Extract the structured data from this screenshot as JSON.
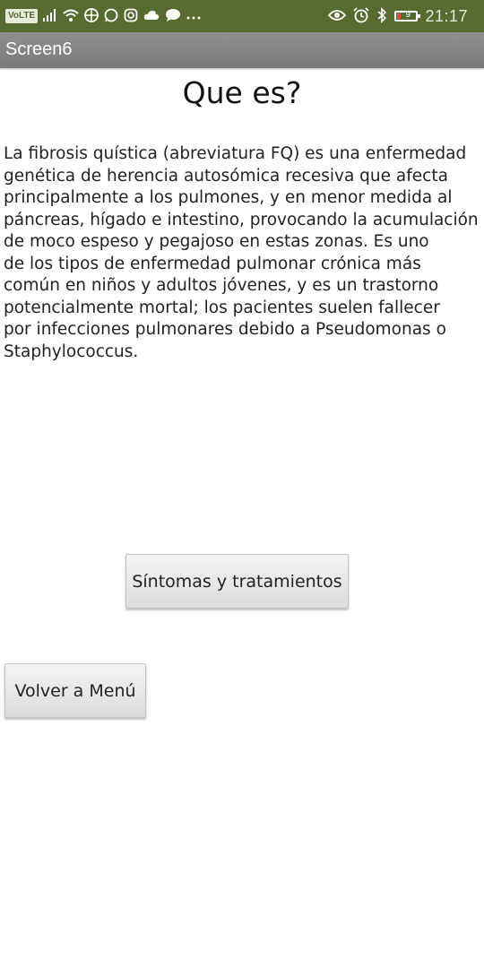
{
  "status_bar": {
    "volte": "VoLTE",
    "battery_level": "9",
    "time": "21:17",
    "icons_left": [
      "signal-icon",
      "wifi-icon",
      "basketball-icon",
      "whatsapp-icon",
      "instagram-icon",
      "cloud-icon",
      "chat-bubble-icon",
      "more-dots-icon"
    ],
    "icons_right": [
      "eye-icon",
      "alarm-icon",
      "bluetooth-icon",
      "battery-icon"
    ],
    "background_color": "#556b2f",
    "battery_low_color": "#e74c3c"
  },
  "title_bar": {
    "title": "Screen6"
  },
  "main": {
    "heading": "Que es?",
    "paragraph": "La fibrosis quística (abreviatura FQ) es una enfermedad\ngenética de herencia autosómica recesiva que afecta\nprincipalmente a los pulmones, y en menor medida al\npáncreas, hígado e intestino, provocando la acumulación\nde moco espeso y pegajoso en estas zonas. Es uno\nde los tipos de enfermedad pulmonar crónica más\ncomún en niños y adultos jóvenes, y es un trastorno\npotencialmente mortal; los pacientes suelen fallecer\npor infecciones pulmonares debido a Pseudomonas o\nStaphylococcus."
  },
  "buttons": {
    "sintomas_label": "Síntomas y tratamientos",
    "volver_label": "Volver a Menú"
  }
}
